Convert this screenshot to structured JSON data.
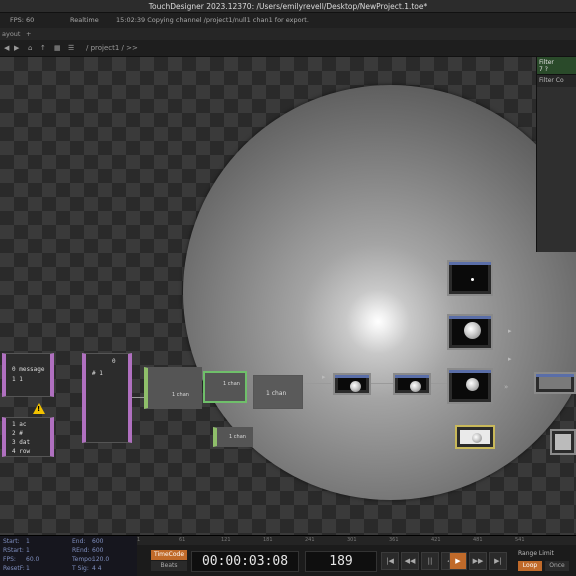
{
  "app": {
    "window_title": "TouchDesigner 2023.12370: /Users/emilyrevell/Desktop/NewProject.1.toe*"
  },
  "status": {
    "fps_label": "FPS: 60",
    "realtime_label": "Realtime",
    "message": "15:02:39 Copying channel /project1/null1 chan1 for export."
  },
  "pathbar": {
    "layout_label": "ayout",
    "plus": "+"
  },
  "toolbar": {
    "path": "/ project1 / >>"
  },
  "nodes": {
    "dat_message": {
      "lines": [
        "0  message",
        "1  1"
      ]
    },
    "dat_rows": {
      "lines": [
        "1  ac",
        "2  #",
        "3  dat",
        "4  row"
      ]
    },
    "dat_right": {
      "lines": [
        "0",
        "# 1"
      ]
    },
    "chop_label": "1 chan",
    "chop_small": "1 chan",
    "chop_mid": "1 chan",
    "chop_big": "1 chan"
  },
  "panel": {
    "header": "Filter",
    "tab1": "Filter",
    "tab2": "Co",
    "small": "7"
  },
  "timeline": {
    "info_rows": [
      [
        "Start:",
        "1",
        "End:",
        "600"
      ],
      [
        "RStart:",
        "1",
        "REnd:",
        "600"
      ],
      [
        "FPS:",
        "60.0",
        "Tempo:",
        "120.0"
      ],
      [
        "ResetF:",
        "1",
        "T Sig:",
        "4   4"
      ]
    ],
    "ruler_ticks": [
      "1",
      "61",
      "121",
      "181",
      "241",
      "301",
      "361",
      "421",
      "481",
      "541"
    ],
    "timecode_button": "TimeCode",
    "beats_button": "Beats",
    "timecode": "00:00:03:08",
    "frame": "189",
    "transport": [
      "|◀",
      "◀◀",
      "||",
      "◀",
      "▶",
      "▶▶",
      "▶|"
    ],
    "range_label": "Range Limit",
    "loop_button": "Loop",
    "once_button": "Once"
  }
}
